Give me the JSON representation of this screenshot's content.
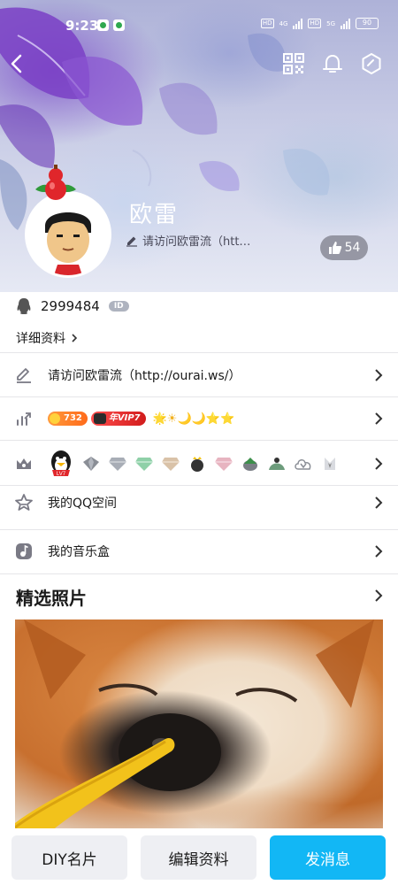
{
  "status_bar": {
    "time": "9:23",
    "network_left": "HD",
    "network_4g": "4G",
    "network_5g": "5G",
    "battery": "90"
  },
  "profile": {
    "nickname": "欧雷",
    "signature": "请访问欧雷流（htt…",
    "likes": "54",
    "qq_number": "2999484",
    "id_badge": "ID",
    "detail_label": "详细资料"
  },
  "rows": {
    "signature_full": "请访问欧雷流（http://ourai.ws/）",
    "vip_level_value": "732",
    "vip_label": "年VIP7",
    "level_icons": "🌟☀🌙🌙⭐⭐",
    "qzone_label": "我的QQ空间",
    "music_label": "我的音乐盒"
  },
  "photos": {
    "title": "精选照片"
  },
  "buttons": {
    "diy": "DIY名片",
    "edit": "编辑资料",
    "message": "发消息"
  },
  "colors": {
    "accent": "#12b7f5",
    "button_gray": "#eeeff3",
    "divider": "#e6e6e9"
  }
}
